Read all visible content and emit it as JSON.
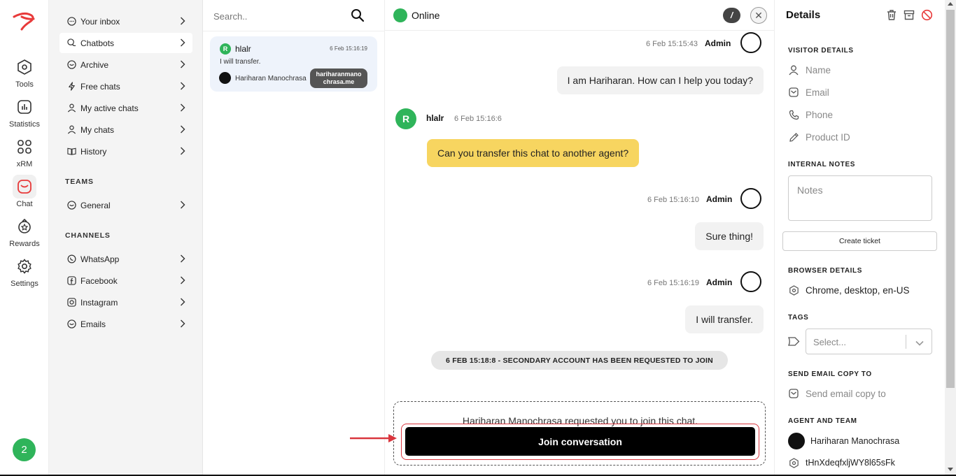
{
  "rail": {
    "items": [
      {
        "label": "Tools",
        "icon": "hexagon-icon"
      },
      {
        "label": "Statistics",
        "icon": "bar-chart-icon"
      },
      {
        "label": "xRM",
        "icon": "grid-icon"
      },
      {
        "label": "Chat",
        "icon": "chat-icon"
      },
      {
        "label": "Rewards",
        "icon": "rewards-icon"
      },
      {
        "label": "Settings",
        "icon": "gear-icon"
      }
    ],
    "badge": "2"
  },
  "nav": {
    "items": [
      {
        "label": "Your inbox"
      },
      {
        "label": "Chatbots"
      },
      {
        "label": "Archive"
      },
      {
        "label": "Free chats"
      },
      {
        "label": "My active chats"
      },
      {
        "label": "My chats"
      },
      {
        "label": "History"
      }
    ],
    "teams_heading": "TEAMS",
    "teams": [
      {
        "label": "General"
      }
    ],
    "channels_heading": "CHANNELS",
    "channels": [
      {
        "label": "WhatsApp"
      },
      {
        "label": "Facebook"
      },
      {
        "label": "Instagram"
      },
      {
        "label": "Emails"
      }
    ]
  },
  "list": {
    "search_placeholder": "Search..",
    "conversation": {
      "avatar": "R",
      "name": "hlalr",
      "time": "6 Feb 15:16:19",
      "message": "I will transfer.",
      "agent": "Hariharan Manochrasa",
      "tooltip": "hariharanmanochrasa.me"
    }
  },
  "chat": {
    "status": "Online",
    "slash": "/",
    "close": "✕",
    "messages": [
      {
        "time": "6 Feb 15:15:43",
        "sender": "Admin",
        "text": "I am Hariharan. How can I help you today?"
      },
      {
        "user_avatar": "R",
        "user_name": "hlalr",
        "time": "6 Feb 15:16:6",
        "text": "Can you transfer this chat to another agent?"
      },
      {
        "time": "6 Feb 15:16:10",
        "sender": "Admin",
        "text": "Sure thing!"
      },
      {
        "time": "6 Feb 15:16:19",
        "sender": "Admin",
        "text": "I will transfer."
      }
    ],
    "system_message": "6 FEB 15:18:8 - SECONDARY ACCOUNT HAS BEEN REQUESTED TO JOIN",
    "request_text": "Hariharan Manochrasa requested you to join this chat.",
    "join_label": "Join conversation"
  },
  "details": {
    "title": "Details",
    "visitor_heading": "VISITOR DETAILS",
    "name_placeholder": "Name",
    "email_placeholder": "Email",
    "phone_placeholder": "Phone",
    "product_placeholder": "Product ID",
    "notes_heading": "INTERNAL NOTES",
    "notes_placeholder": "Notes",
    "ticket_label": "Create ticket",
    "browser_heading": "BROWSER DETAILS",
    "browser_value": "Chrome, desktop, en-US",
    "tags_heading": "TAGS",
    "tags_placeholder": "Select...",
    "send_heading": "SEND EMAIL COPY TO",
    "send_placeholder": "Send email copy to",
    "agent_heading": "AGENT AND TEAM",
    "agent_name": "Hariharan Manochrasa",
    "agent_id": "tHnXdeqfxljWY8l65sFk"
  },
  "colors": {
    "brand": "#e83a3a",
    "online": "#2fb45a",
    "user_bubble": "#f7d560",
    "highlight": "#d9363e"
  }
}
